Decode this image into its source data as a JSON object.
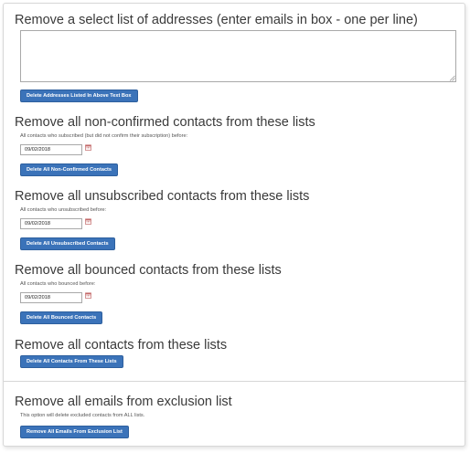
{
  "remove_select": {
    "heading": "Remove a select list of addresses (enter emails in box - one per line)",
    "textarea_value": "",
    "button": "Delete Addresses Listed In Above Text Box"
  },
  "non_confirmed": {
    "heading": "Remove all non-confirmed contacts from these lists",
    "label": "All contacts who subscribed (but did not confirm their subscription) before:",
    "date": "09/02/2018",
    "button": "Delete All Non-Confirmed Contacts"
  },
  "unsubscribed": {
    "heading": "Remove all unsubscribed contacts from these lists",
    "label": "All contacts who unsubscribed before:",
    "date": "09/02/2018",
    "button": "Delete All Unsubscribed Contacts"
  },
  "bounced": {
    "heading": "Remove all bounced contacts from these lists",
    "label": "All contacts who bounced before:",
    "date": "09/02/2018",
    "button": "Delete All Bounced Contacts"
  },
  "all_contacts": {
    "heading": "Remove all contacts from these lists",
    "button": "Delete All Contacts From These Lists"
  },
  "exclusion": {
    "heading": "Remove all emails from exclusion list",
    "label": "This option will delete excluded contacts from ALL lists.",
    "button": "Remove All Emails From Exclusion List"
  },
  "icons": {
    "calendar": "calendar-icon",
    "resize": "resize-grip-icon"
  },
  "colors": {
    "button_bg": "#3b73b9",
    "button_border": "#2d5f9e",
    "calendar": "#c46a6a"
  }
}
